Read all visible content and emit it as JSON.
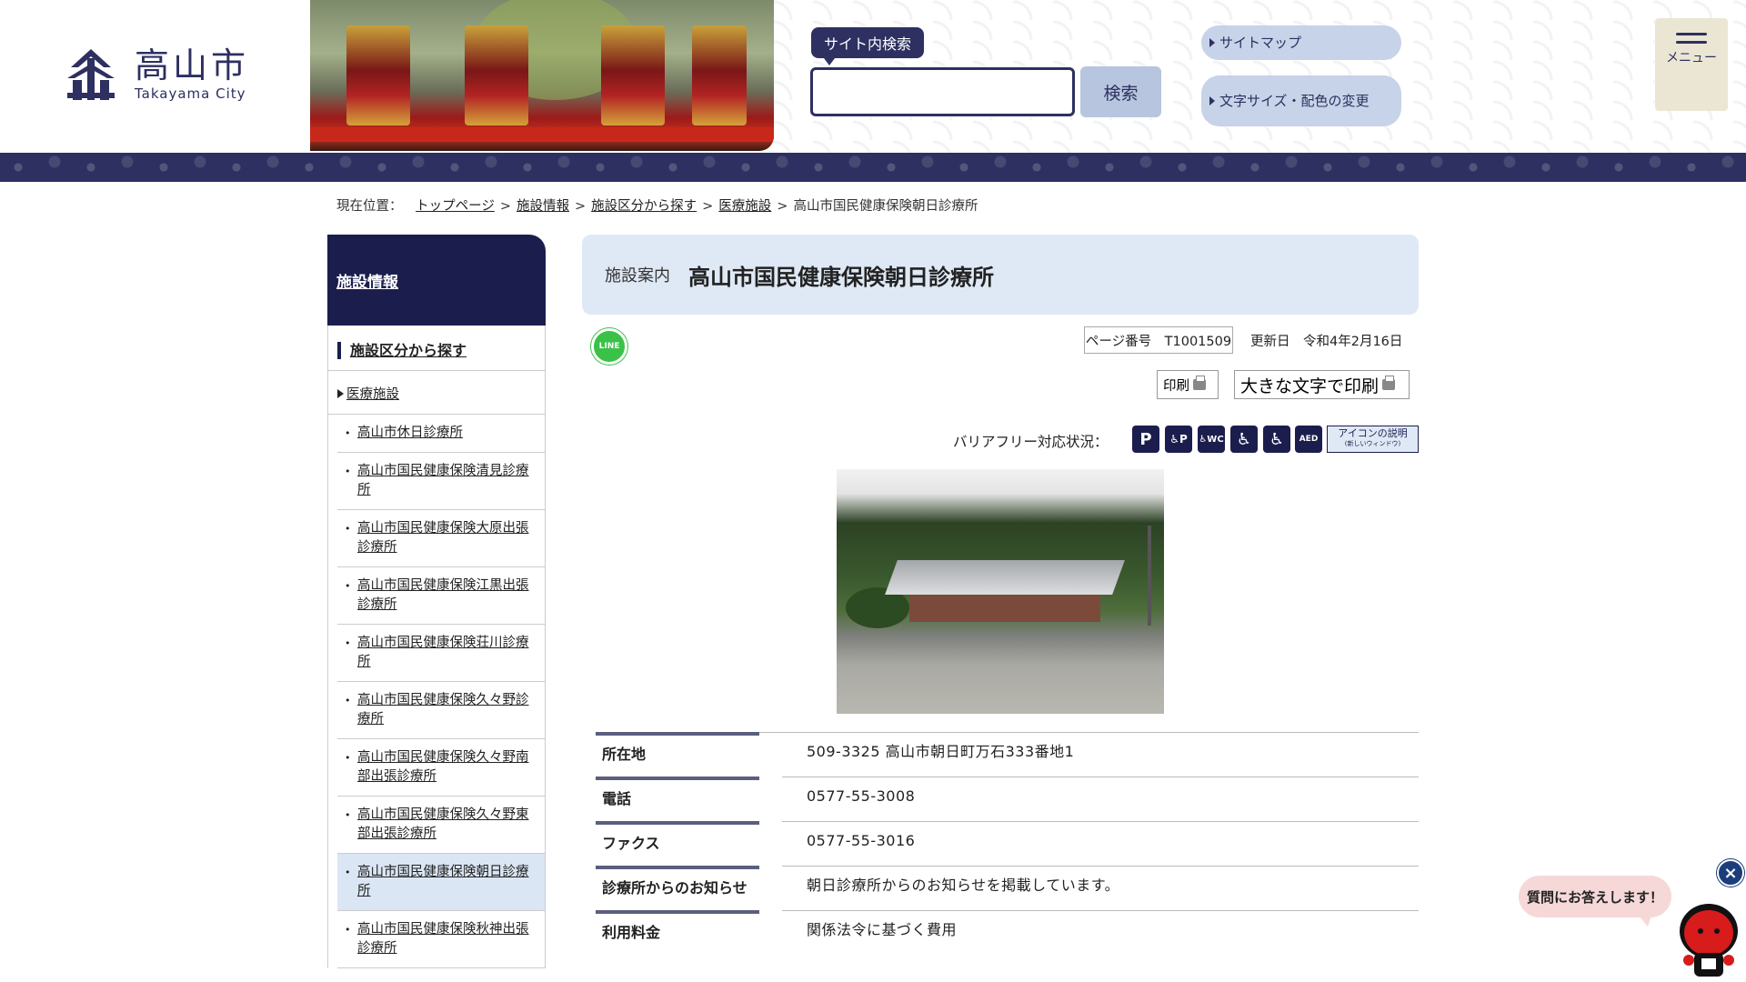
{
  "header": {
    "logo_jp": "高山市",
    "logo_en": "Takayama City",
    "search_label": "サイト内検索",
    "search_placeholder": "",
    "search_button": "検索",
    "sitemap": "サイトマップ",
    "text_size": "文字サイズ・配色の変更",
    "menu": "メニュー"
  },
  "breadcrumb": {
    "prefix": "現在位置：",
    "items": [
      "トップページ",
      "施設情報",
      "施設区分から探す",
      "医療施設"
    ],
    "current": "高山市国民健康保険朝日診療所"
  },
  "sidebar": {
    "heading": "施設情報",
    "category": "施設区分から探す",
    "subcategory": "医療施設",
    "items": [
      "高山市休日診療所",
      "高山市国民健康保険清見診療所",
      "高山市国民健康保険大原出張診療所",
      "高山市国民健康保険江黒出張診療所",
      "高山市国民健康保険荘川診療所",
      "高山市国民健康保険久々野診療所",
      "高山市国民健康保険久々野南部出張診療所",
      "高山市国民健康保険久々野東部出張診療所",
      "高山市国民健康保険朝日診療所",
      "高山市国民健康保険秋神出張診療所"
    ]
  },
  "main": {
    "category": "施設案内",
    "title": "高山市国民健康保険朝日診療所",
    "line_label": "LINE",
    "page_number": "ページ番号　T1001509",
    "updated": "更新日　令和4年2月16日",
    "print": "印刷",
    "print_large": "大きな文字で印刷",
    "barrier_free": "バリアフリー対応状況：",
    "barrier_icons": [
      "P",
      "♿P",
      "♿WC",
      "♿",
      "♿",
      "AED"
    ],
    "icon_explain": "アイコンの説明",
    "icon_explain_sub": "(新しいウィンドウ)",
    "info": [
      {
        "label": "所在地",
        "value": "509-3325 高山市朝日町万石333番地1"
      },
      {
        "label": "電話",
        "value": "0577-55-3008"
      },
      {
        "label": "ファクス",
        "value": "0577-55-3016"
      },
      {
        "label": "診療所からのお知らせ",
        "value": "朝日診療所からのお知らせを掲載しています。"
      },
      {
        "label": "利用料金",
        "value": "関係法令に基づく費用"
      }
    ]
  },
  "chat": {
    "bubble": "質問にお答えします！",
    "close": "×"
  },
  "colors": {
    "navy": "#1b1e4d",
    "title_bg": "#dfe9f5",
    "active_bg": "#dbe6f4",
    "line_green": "#3ac248"
  }
}
